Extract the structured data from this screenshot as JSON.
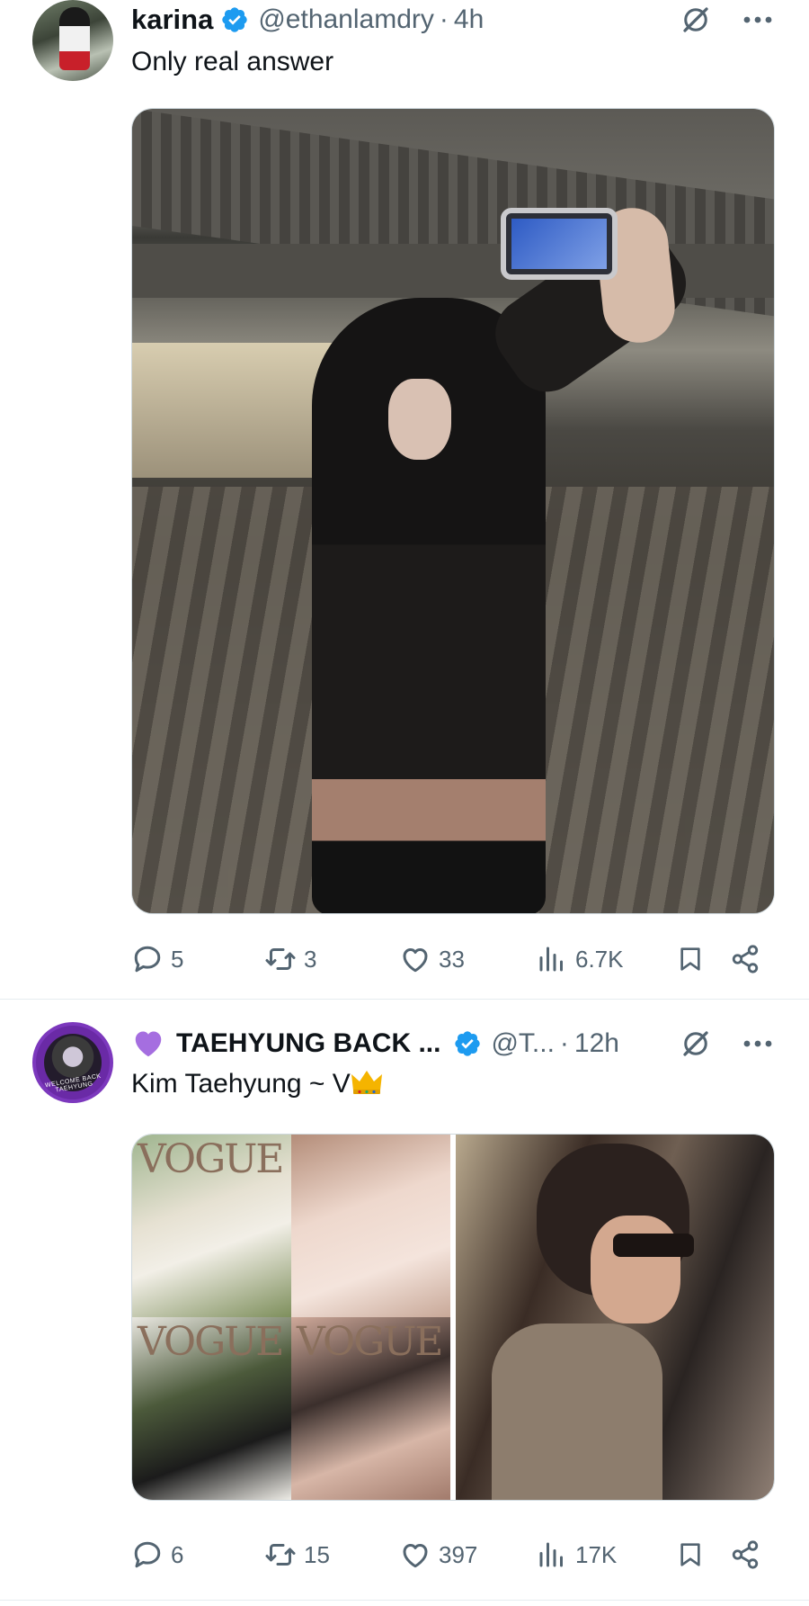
{
  "tweets": [
    {
      "name": "karina",
      "handle": "@ethanlamdry",
      "separator": "·",
      "time": "4h",
      "text": "Only real answer",
      "stats": {
        "replies": "5",
        "retweets": "3",
        "likes": "33",
        "views": "6.7K"
      }
    },
    {
      "name": "TAEHYUNG BACK ...",
      "handle": "@T...",
      "separator": "·",
      "time": "12h",
      "text": "Kim Taehyung ~ V",
      "avatar_ring_text": "WELCOME BACK TAEHYUNG",
      "media_texts": [
        "VOGUE",
        "VOGUE",
        "VOGUE"
      ],
      "stats": {
        "replies": "6",
        "retweets": "15",
        "likes": "397",
        "views": "17K"
      }
    }
  ],
  "colors": {
    "verified": "#1d9bf0",
    "muted": "#536471",
    "text": "#0f1419",
    "purple_heart": "#a56ee0"
  },
  "icons": [
    "verified-badge-icon",
    "grok-icon",
    "more-icon",
    "reply-icon",
    "retweet-icon",
    "like-icon",
    "views-icon",
    "bookmark-icon",
    "share-icon",
    "purple-heart-emoji",
    "crown-emoji"
  ]
}
